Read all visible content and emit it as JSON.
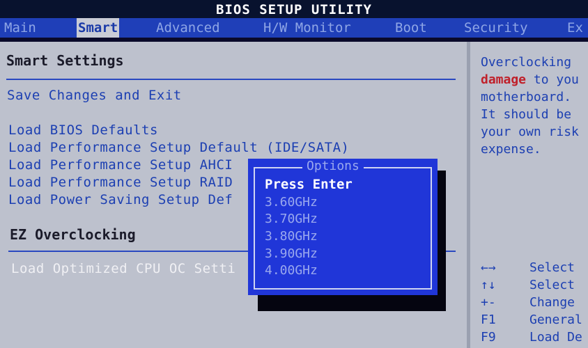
{
  "title": "BIOS SETUP UTILITY",
  "tabs": [
    {
      "label": "Main"
    },
    {
      "label": "Smart"
    },
    {
      "label": "Advanced"
    },
    {
      "label": "H/W Monitor"
    },
    {
      "label": "Boot"
    },
    {
      "label": "Security"
    },
    {
      "label": "Ex"
    }
  ],
  "main": {
    "section_title": "Smart Settings",
    "save_exit": "Save Changes and Exit",
    "items": [
      "Load BIOS Defaults",
      "Load Performance Setup Default (IDE/SATA)",
      "Load Performance Setup AHCI",
      "Load Performance Setup RAID",
      "Load Power Saving Setup Def"
    ],
    "ez_title": "EZ Overclocking",
    "ez_item": "Load Optimized CPU OC Setti"
  },
  "help": {
    "line1": "Overclocking",
    "line2_warn": "damage",
    "line2_rest": " to you",
    "line3": "motherboard.",
    "line4": "It should be",
    "line5": "your own risk",
    "line6": "expense."
  },
  "keys": [
    {
      "key": "←→",
      "desc": "Select"
    },
    {
      "key": "↑↓",
      "desc": "Select"
    },
    {
      "key": "+-",
      "desc": "Change"
    },
    {
      "key": "F1",
      "desc": "General"
    },
    {
      "key": "F9",
      "desc": "Load De"
    }
  ],
  "popup": {
    "title": "Options",
    "selected": "Press Enter",
    "options": [
      "3.60GHz",
      "3.70GHz",
      "3.80GHz",
      "3.90GHz",
      "4.00GHz"
    ]
  },
  "colors": {
    "background": "#bdc1cd",
    "tab_bar": "#1f3fb8",
    "item_text": "#1c3fb2",
    "warning": "#c0202a",
    "popup": "#2036d8"
  }
}
